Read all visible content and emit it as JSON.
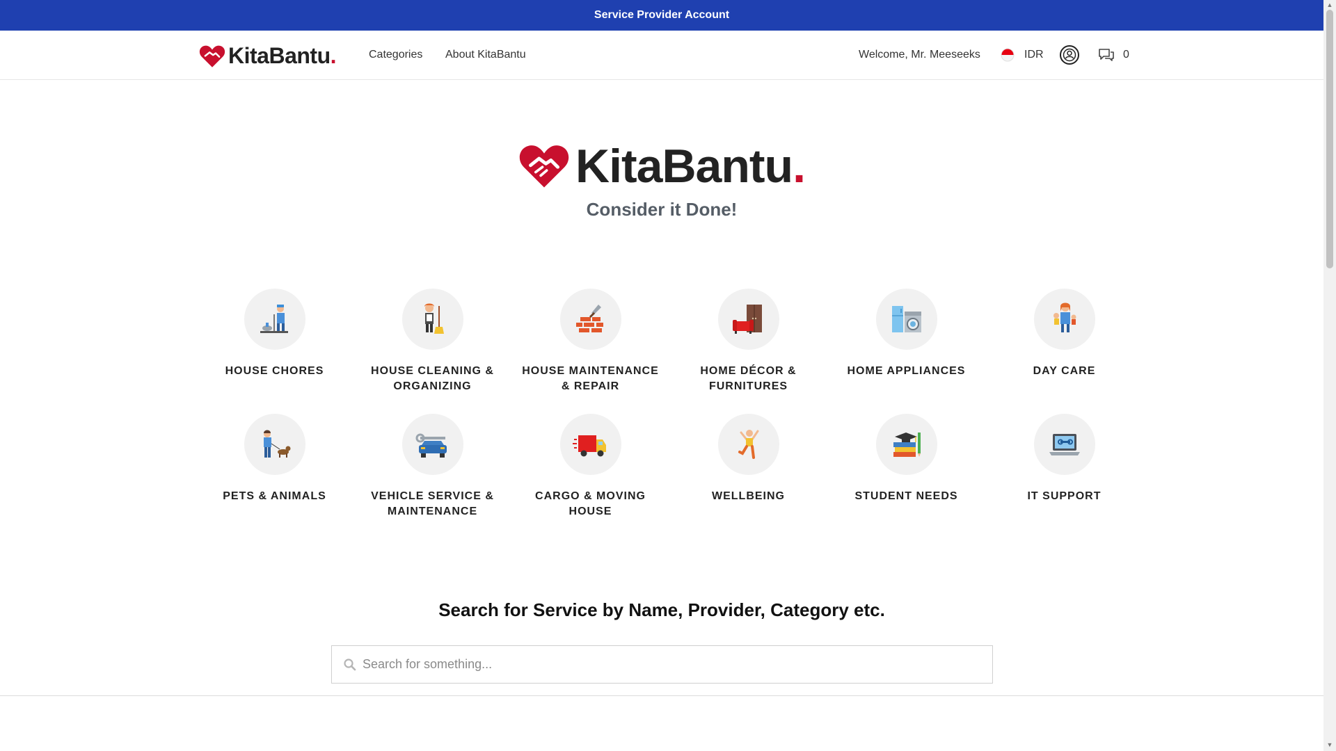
{
  "topbar": {
    "label": "Service Provider Account"
  },
  "nav": {
    "brand": "KitaBantu",
    "brand_dot": ".",
    "links": [
      {
        "label": "Categories"
      },
      {
        "label": "About KitaBantu"
      }
    ],
    "welcome": "Welcome, Mr. Meeseeks",
    "currency": "IDR",
    "message_count": "0"
  },
  "hero": {
    "brand": "KitaBantu",
    "brand_dot": ".",
    "tagline": "Consider it Done!"
  },
  "categories": [
    {
      "label": "HOUSE CHORES",
      "icon": "house-chores-icon"
    },
    {
      "label": "HOUSE CLEANING & ORGANIZING",
      "icon": "cleaning-icon"
    },
    {
      "label": "HOUSE MAINTENANCE & REPAIR",
      "icon": "bricks-icon"
    },
    {
      "label": "HOME DÉCOR & FURNITURES",
      "icon": "furniture-icon"
    },
    {
      "label": "HOME APPLIANCES",
      "icon": "appliances-icon"
    },
    {
      "label": "DAY CARE",
      "icon": "daycare-icon"
    },
    {
      "label": "PETS & ANIMALS",
      "icon": "pet-icon"
    },
    {
      "label": "VEHICLE SERVICE & MAINTENANCE",
      "icon": "car-wrench-icon"
    },
    {
      "label": "CARGO & MOVING HOUSE",
      "icon": "truck-icon"
    },
    {
      "label": "WELLBEING",
      "icon": "wellbeing-icon"
    },
    {
      "label": "STUDENT NEEDS",
      "icon": "books-icon"
    },
    {
      "label": "IT SUPPORT",
      "icon": "laptop-icon"
    }
  ],
  "search": {
    "title": "Search for Service by Name, Provider, Category etc.",
    "placeholder": "Search for something..."
  },
  "colors": {
    "topbar": "#1f40b0",
    "brand_red": "#c8102e",
    "tagline": "#555d66"
  }
}
